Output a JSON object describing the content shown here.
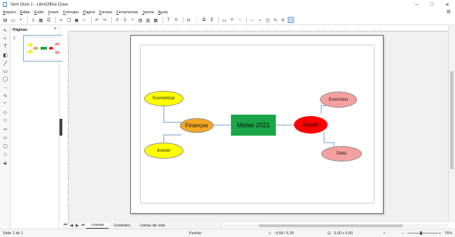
{
  "window": {
    "title": "Sem título 1 - LibreOffice Draw"
  },
  "menu": [
    "Arquivo",
    "Editar",
    "Exibir",
    "Inserir",
    "Formatar",
    "Página",
    "Formas",
    "Ferramentas",
    "Janela",
    "Ajuda"
  ],
  "pages_panel": {
    "title": "Páginas",
    "page_number": "1"
  },
  "diagram": {
    "center": {
      "label": "Metas 2021",
      "color": "#1aa548"
    },
    "financas": {
      "label": "Finanças",
      "color": "#f5a623"
    },
    "economizar": {
      "label": "Economizar",
      "color": "#ffff00"
    },
    "investir": {
      "label": "Investir",
      "color": "#ffff00"
    },
    "saude": {
      "label": "Saúde",
      "color": "#ff0000"
    },
    "exercicios": {
      "label": "Exercícios",
      "color": "#f5a0a0"
    },
    "dieta": {
      "label": "Dieta",
      "color": "#f5a0a0"
    }
  },
  "tabs": [
    "Leiaute",
    "Controles",
    "Linhas de cota"
  ],
  "status": {
    "slide": "Slide 1 de 1",
    "layout": "Padrão",
    "position": "-9,58 / 5,35",
    "size": "0,00 x 0,00",
    "zoom": "75%"
  }
}
